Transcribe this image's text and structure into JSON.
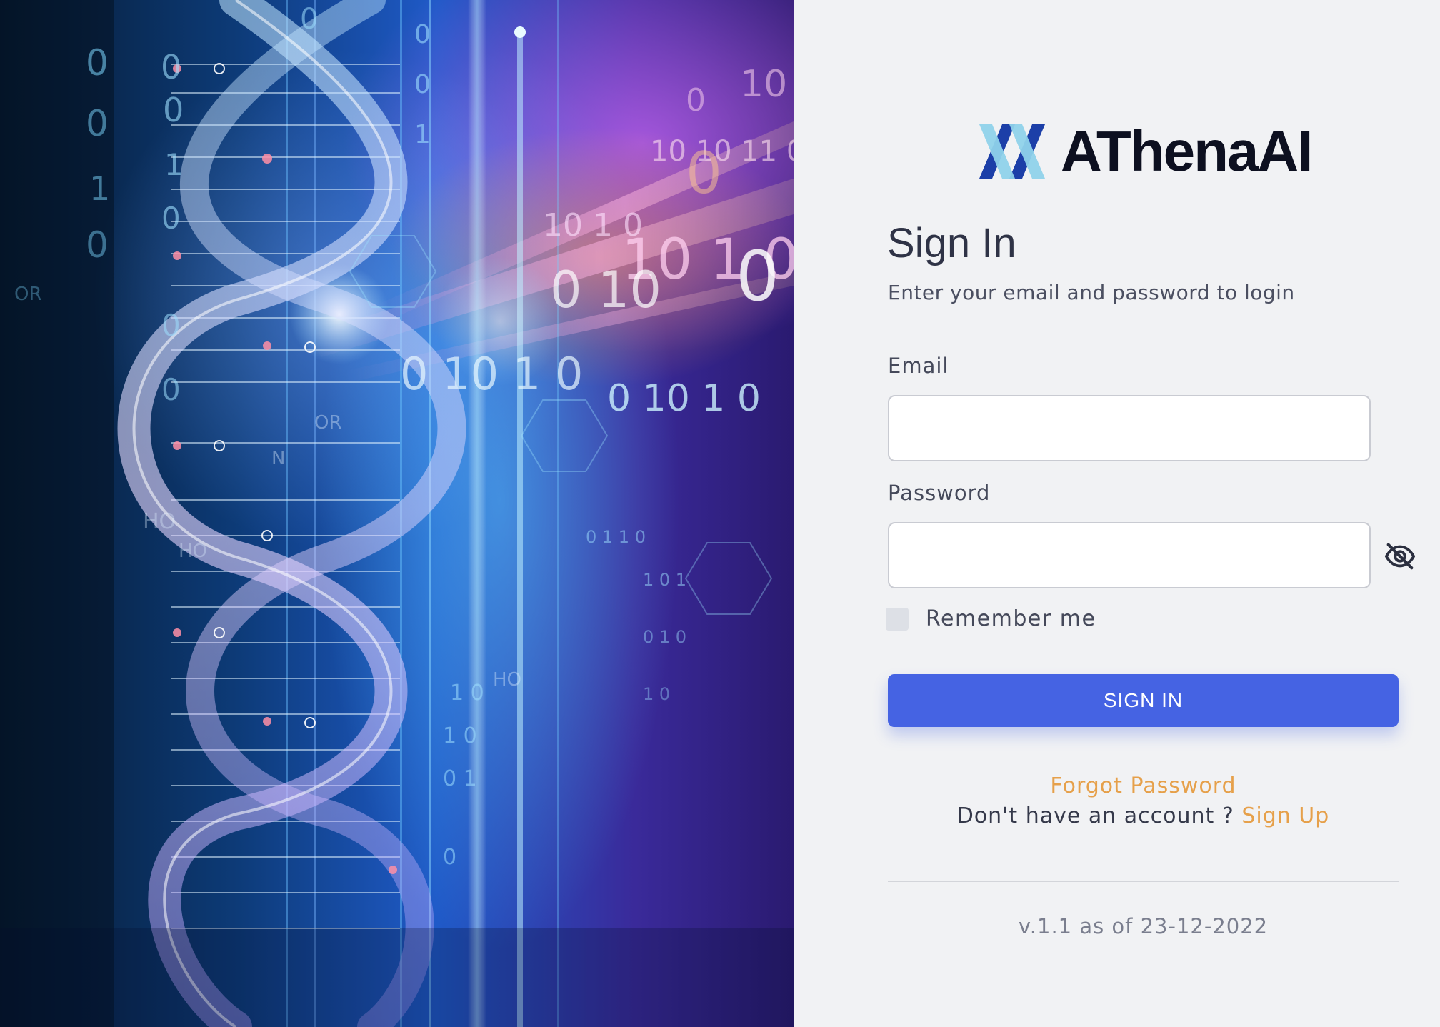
{
  "brand": {
    "name": "AThenaAI",
    "logo_icon": "athena-logo-icon"
  },
  "login": {
    "title": "Sign In",
    "subtitle": "Enter your email and password to login",
    "email_label": "Email",
    "email_value": "",
    "password_label": "Password",
    "password_value": "",
    "password_toggle_icon": "eye-off-icon",
    "remember_label": "Remember me",
    "remember_checked": false,
    "signin_label": "SIGN IN",
    "forgot_label": "Forgot Password",
    "no_account_text": "Don't have an account ? ",
    "signup_label": "Sign Up"
  },
  "footer": {
    "version": "v.1.1 as of 23-12-2022"
  },
  "hero": {
    "image": "dna-binary-code-illustration",
    "binary_texts": [
      "0",
      "10",
      "1",
      "01",
      "10 1 0",
      "0 10 1 0",
      "1 0",
      "OR",
      "HO",
      "N"
    ]
  },
  "colors": {
    "accent": "#4563e3",
    "link": "#e6a04a",
    "background": "#f1f2f4",
    "logo_dark": "#1c3fa8",
    "logo_light": "#8fd2ea"
  }
}
